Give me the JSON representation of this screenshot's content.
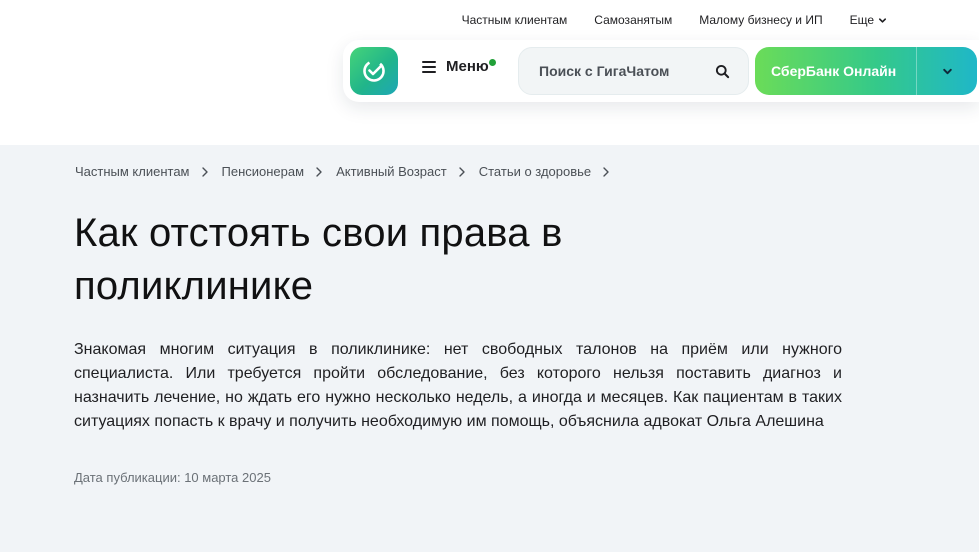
{
  "topnav": {
    "items": [
      "Частным клиентам",
      "Самозанятым",
      "Малому бизнесу и ИП"
    ],
    "more_label": "Еще"
  },
  "header": {
    "menu_label": "Меню",
    "search_placeholder": "Поиск с ГигаЧатом",
    "online_label": "СберБанк Онлайн"
  },
  "breadcrumb": [
    "Частным клиентам",
    "Пенсионерам",
    "Активный Возраст",
    "Статьи о здоровье"
  ],
  "article": {
    "title": "Как отстоять свои права в поликлинике",
    "lead": "Знакомая многим ситуация в поликлинике: нет свободных талонов на приём или нужного специалиста. Или требуется пройти обследование, без которого нельзя поставить диагноз и назначить лечение, но ждать его нужно несколько недель, а иногда и месяцев. Как пациентам в таких ситуациях попасть к врачу и получить необходимую им помощь, объяснила адвокат Ольга Алешина",
    "date": "Дата публикации: 10 марта 2025"
  },
  "icons": {
    "logo": "sber-check-icon",
    "menu": "burger-icon",
    "search": "search-icon",
    "chevron": "chevron-down-icon",
    "breadcrumb_sep": "chevron-right-icon"
  },
  "colors": {
    "brand_green": "#21a038",
    "page_bg": "#f1f4f7",
    "online_gradient_start": "#6bdc58",
    "online_gradient_end": "#1fb7c8"
  }
}
